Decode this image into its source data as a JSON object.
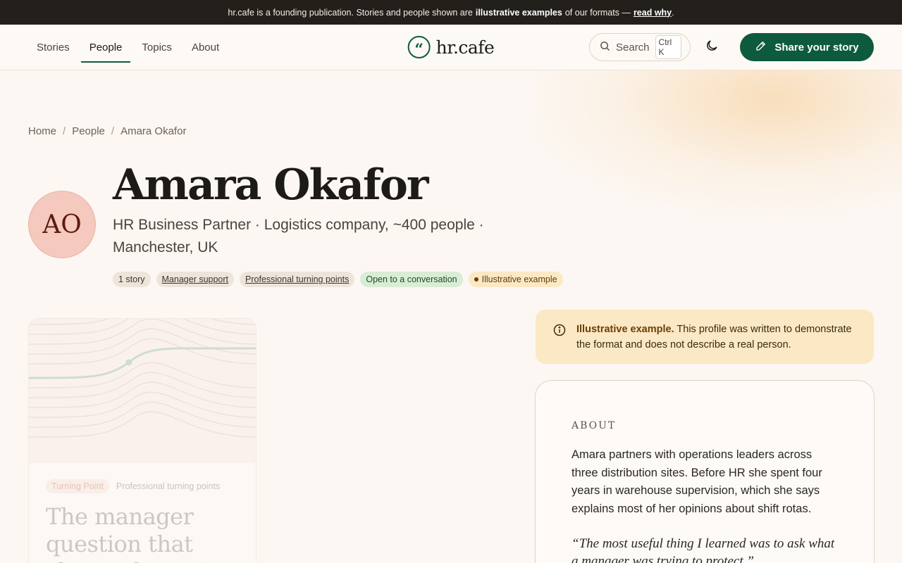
{
  "banner": {
    "text_before": "hr.cafe is a founding publication. Stories and people shown are",
    "bold": "illustrative examples",
    "text_after": "of our formats —",
    "link": "read why",
    "end": "."
  },
  "nav": {
    "items": [
      {
        "label": "Stories",
        "active": false
      },
      {
        "label": "People",
        "active": true
      },
      {
        "label": "Topics",
        "active": false
      },
      {
        "label": "About",
        "active": false
      }
    ]
  },
  "logo": {
    "mark": "“",
    "text": "hr.cafe"
  },
  "search": {
    "label": "Search",
    "shortcut": "Ctrl K"
  },
  "share_button": {
    "label": "Share your story"
  },
  "breadcrumb": {
    "items": [
      "Home",
      "People",
      "Amara Okafor"
    ],
    "separator": "/"
  },
  "profile": {
    "initials": "AO",
    "name": "Amara Okafor",
    "role": "HR Business Partner · Logistics company, ~400 people · Manchester, UK",
    "tags": [
      {
        "label": "1 story",
        "style": "neutral"
      },
      {
        "label": "Manager support",
        "style": "link"
      },
      {
        "label": "Professional turning points",
        "style": "link"
      },
      {
        "label": "Open to a conversation",
        "style": "green"
      },
      {
        "label": "Illustrative example",
        "style": "amber"
      }
    ]
  },
  "story_card": {
    "badge": "Turning Point",
    "topic": "Professional turning points",
    "title": "The manager question that changed my view"
  },
  "notice": {
    "bold": "Illustrative example.",
    "text": "This profile was written to demonstrate the format and does not describe a real person."
  },
  "about": {
    "label": "ABOUT",
    "text": "Amara partners with operations leaders across three distribution sites. Before HR she spent four years in warehouse supervision, which she says explains most of her opinions about shift rotas.",
    "quote": "“The most useful thing I learned was to ask what a manager was trying to protect.”"
  },
  "colors": {
    "accent": "#0e5a3f",
    "banner_bg": "#231f1b",
    "avatar_bg": "#f5c9bd",
    "notice_bg": "#fbe8c4"
  }
}
